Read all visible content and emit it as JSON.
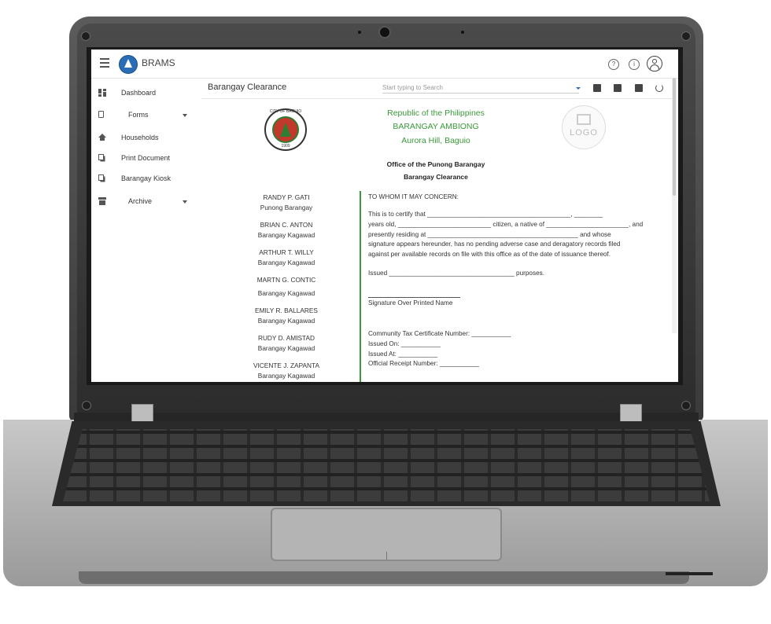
{
  "app": {
    "title": "BRAMS"
  },
  "topbar": {
    "icons": [
      "help-icon",
      "info-icon",
      "account-icon"
    ]
  },
  "sidebar": {
    "items": [
      {
        "label": "Dashboard",
        "icon": "dashboard-icon"
      },
      {
        "label": "Forms",
        "icon": "document-icon",
        "expandable": true
      },
      {
        "label": "Households",
        "icon": "home-icon"
      },
      {
        "label": "Print Document",
        "icon": "copy-icon"
      },
      {
        "label": "Barangay Kiosk",
        "icon": "copy-icon"
      },
      {
        "label": "Archive",
        "icon": "archive-icon",
        "expandable": true
      }
    ]
  },
  "content": {
    "breadcrumb": "Barangay Clearance",
    "search_placeholder": "Start typing to Search",
    "tools": [
      "edit-document-icon",
      "print-icon",
      "pdf-icon",
      "refresh-icon"
    ]
  },
  "document": {
    "seal": {
      "top_text": "CITY OF BAGUIO",
      "year": "1909"
    },
    "header": [
      "Republic of the Philippines",
      "BARANGAY AMBIONG",
      "Aurora Hill, Baguio"
    ],
    "logo_text": "LOGO",
    "office": "Office of the Punong Barangay",
    "doc_type": "Barangay Clearance",
    "officials": [
      {
        "name": "RANDY P. GATI",
        "position": "Punong Barangay"
      },
      {
        "name": "BRIAN C. ANTON",
        "position": "Barangay Kagawad"
      },
      {
        "name": "ARTHUR T. WILLY",
        "position": "Barangay Kagawad"
      },
      {
        "name": "MARTN G. CONTIC",
        "position": "Barangay Kagawad"
      },
      {
        "name": "EMILY R. BALLARES",
        "position": "Barangay Kagawad"
      },
      {
        "name": "RUDY D. AMISTAD",
        "position": "Barangay Kagawad"
      },
      {
        "name": "VICENTE J. ZAPANTA",
        "position": "Barangay Kagawad"
      }
    ],
    "salutation": "TO WHOM IT MAY CONCERN:",
    "paragraph": [
      "This is to certify that ________________________________________, ________",
      "years old, __________________________ citizen, a native of _______________________, and",
      "presently residing at __________________________________________ and whose",
      "signature appears hereunder, has no pending adverse case and deragatory records filed",
      "against per available records on file with this office as of the date of issuance thereof."
    ],
    "issued": "Issued ___________________________________ purposes.",
    "signature_label": "Signature Over Printed Name",
    "footer": [
      "Community Tax Certificate Number: ___________",
      "Issued On: ___________",
      "Issued At: ___________",
      "Official Receipt Number: ___________"
    ]
  }
}
